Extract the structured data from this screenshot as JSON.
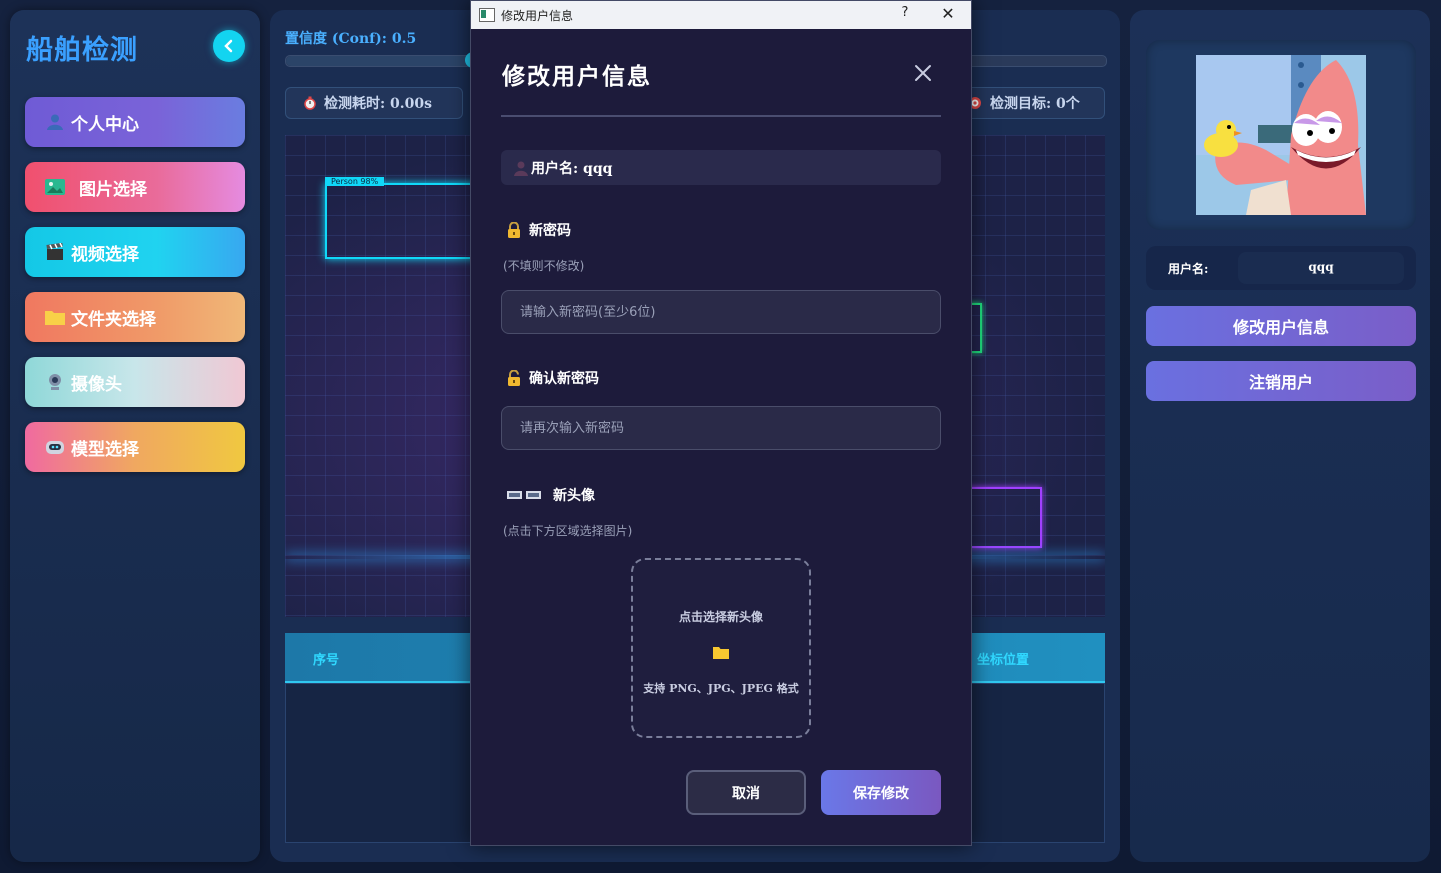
{
  "sidebar": {
    "title": "船舶检测",
    "items": [
      {
        "label": "个人中心",
        "icon": "user-icon"
      },
      {
        "label": "图片选择",
        "icon": "image-icon"
      },
      {
        "label": "视频选择",
        "icon": "clapper-icon"
      },
      {
        "label": "文件夹选择",
        "icon": "folder-icon"
      },
      {
        "label": "摄像头",
        "icon": "webcam-icon"
      },
      {
        "label": "模型选择",
        "icon": "robot-icon"
      }
    ]
  },
  "main": {
    "confidence_label": "置信度 (Conf): 0.5",
    "confidence_value": 0.5,
    "time_label": "检测耗时: 0.00s",
    "targets_label": "检测目标: 0个",
    "detection_box_label": "Person 98%",
    "table_headers": [
      "序号",
      "坐标位置"
    ]
  },
  "right": {
    "username_label": "用户名:",
    "username_value": "qqq",
    "edit_button": "修改用户信息",
    "logout_button": "注销用户"
  },
  "modal": {
    "window_title": "修改用户信息",
    "help_glyph": "?",
    "close_glyph": "✕",
    "heading": "修改用户信息",
    "username_text": "用户名: qqq",
    "new_password_label": "新密码",
    "new_password_hint": "(不填则不修改)",
    "new_password_placeholder": "请输入新密码(至少6位)",
    "confirm_password_label": "确认新密码",
    "confirm_password_placeholder": "请再次输入新密码",
    "avatar_label": "新头像",
    "avatar_hint": "(点击下方区域选择图片)",
    "upload_title": "点击选择新头像",
    "upload_formats": "支持 PNG、JPG、JPEG 格式",
    "cancel_button": "取消",
    "save_button": "保存修改"
  },
  "colors": {
    "accent_cyan": "#13d4f0",
    "modal_bg": "#1d1b3b",
    "primary_button": "#6a70e0"
  }
}
